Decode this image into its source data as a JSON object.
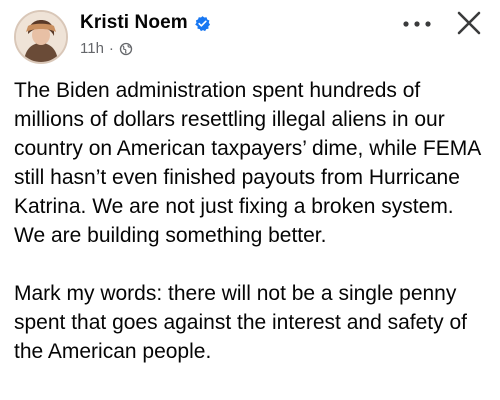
{
  "post": {
    "author": {
      "name": "Kristi Noem",
      "verified_icon": "verified-badge-icon",
      "verified_color": "#1877f2"
    },
    "meta": {
      "timestamp": "11h",
      "separator": "·",
      "audience_icon": "globe-icon"
    },
    "actions": {
      "more_icon": "more-horizontal-icon",
      "close_icon": "close-icon"
    },
    "body": {
      "paragraphs": [
        "The Biden administration spent hundreds of millions of dollars resettling illegal aliens in our country on American taxpayers’ dime, while FEMA still hasn’t even finished payouts from Hurricane Katrina. We are not just fixing a broken system. We are building something better.",
        "Mark my words: there will not be a single penny spent that goes against the interest and safety of the American people."
      ]
    }
  }
}
